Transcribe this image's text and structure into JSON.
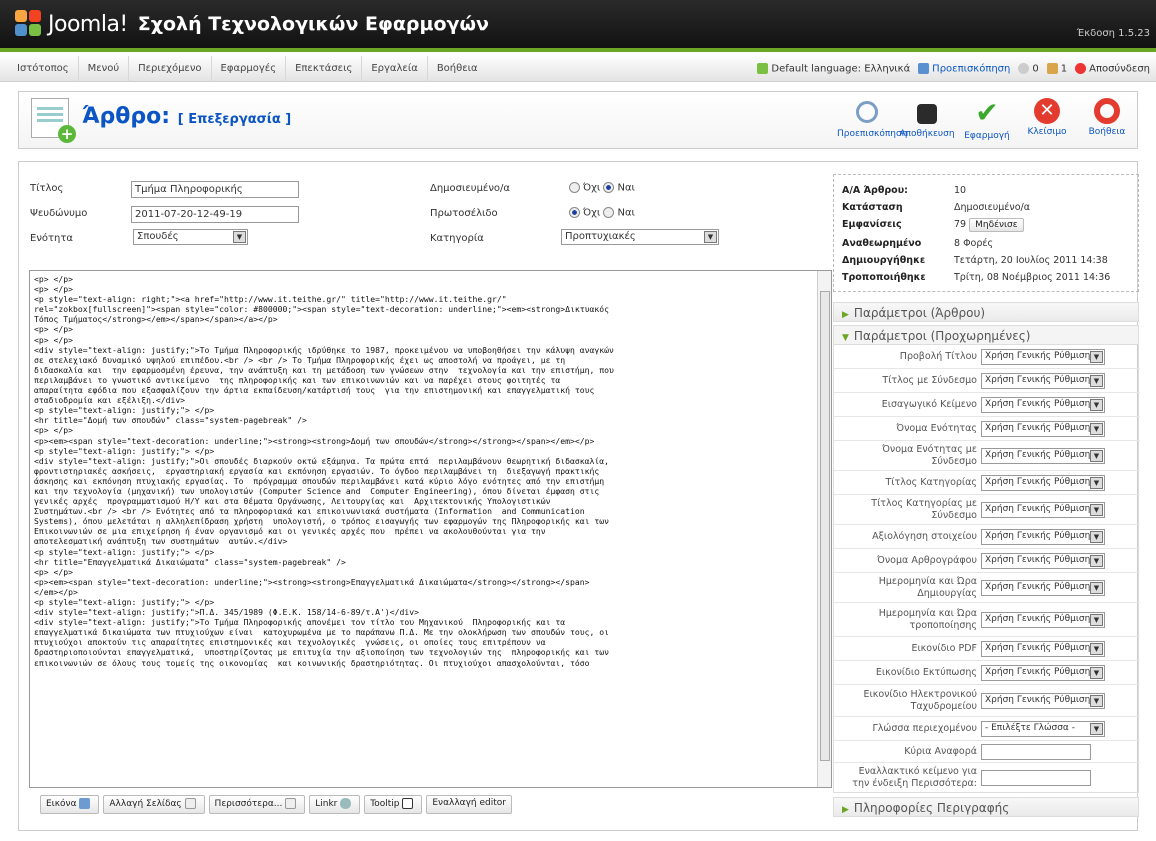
{
  "header": {
    "brand": "Joomla!",
    "site_name": "Σχολή Τεχνολογικών Εφαρμογών",
    "version": "Έκδοση 1.5.23"
  },
  "menu": [
    "Ιστότοπος",
    "Μενού",
    "Περιεχόμενο",
    "Εφαρμογές",
    "Επεκτάσεις",
    "Εργαλεία",
    "Βοήθεια"
  ],
  "status": {
    "language": "Default language: Ελληνικά",
    "preview": "Προεπισκόπηση",
    "messages": "0",
    "users": "1",
    "logout": "Αποσύνδεση"
  },
  "toolbar": {
    "title": "Άρθρο:",
    "subtitle": "[ Επεξεργασία ]",
    "buttons": [
      "Προεπισκόπηση",
      "Αποθήκευση",
      "Εφαρμογή",
      "Κλείσιμο",
      "Βοήθεια"
    ]
  },
  "form": {
    "title_label": "Τίτλος",
    "title_value": "Τμήμα Πληροφορικής",
    "alias_label": "Ψευδώνυμο",
    "alias_value": "2011-07-20-12-49-19",
    "section_label": "Ενότητα",
    "section_value": "Σπουδές",
    "published_label": "Δημοσιευμένο/α",
    "frontpage_label": "Πρωτοσέλιδο",
    "no": "Όχι",
    "yes": "Ναι",
    "category_label": "Κατηγορία",
    "category_value": "Προπτυχιακές"
  },
  "editor_code": "<p> </p>\n<p> </p>\n<p style=\"text-align: right;\"><a href=\"http://www.it.teithe.gr/\" title=\"http://www.it.teithe.gr/\"\nrel=\"zokbox[fullscreen]\"><span style=\"color: #800000;\"><span style=\"text-decoration: underline;\"><em><strong>Δικτυακός\nΤόπος Τμήματος</strong></em></span></span></a></p>\n<p> </p>\n<p> </p>\n<div style=\"text-align: justify;\">Το Τμήμα Πληροφορικής ιδρύθηκε το 1987, προκειμένου να υποβοηθήσει την κάλυψη αναγκών\nσε στελεχιακό δυναμικό υψηλού επιπέδου.<br /> <br /> Το Τμήμα Πληροφορικής έχει ως αποστολή να προάγει, με τη\nδιδασκαλία και  την εφαρμοσμένη έρευνα, την ανάπτυξη και τη μετάδοση των γνώσεων στην  τεχνολογία και την επιστήμη, που\nπεριλαμβάνει το γνωστικό αντικείμενο  της πληροφορικής και των επικοινωνιών και να παρέχει στους φοιτητές τα\nαπαραίτητα εφόδια που εξασφαλίζουν την άρτια εκπαίδευση/κατάρτισή τους  για την επιστημονική και επαγγελματική τους\nσταδιοδρομία και εξέλιξη.</div>\n<p style=\"text-align: justify;\"> </p>\n<hr title=\"Δομή των σπουδών\" class=\"system-pagebreak\" />\n<p> </p>\n<p><em><span style=\"text-decoration: underline;\"><strong><strong>Δομή των σπουδών</strong></strong></span></em></p>\n<p style=\"text-align: justify;\"> </p>\n<div style=\"text-align: justify;\">Οι σπουδές διαρκούν οκτώ εξάμηνα. Τα πρώτα επτά  περιλαμβάνουν θεωρητική διδασκαλία,\nφροντιστηριακές ασκήσεις,  εργαστηριακή εργασία και εκπόνηση εργασιών. Το όγδοο περιλαμβάνει τη  διεξαγωγή πρακτικής\nάσκησης και εκπόνηση πτυχιακής εργασίας. Το  πρόγραμμα σπουδών περιλαμβάνει κατά κύριο λόγο ενότητες από την επιστήμη\nκαι την τεχνολογία (μηχανική) των υπολογιστών (Computer Science and  Computer Engineering), όπου δίνεται έμφαση στις\nγενικές αρχές  προγραμματισμού Η/Υ και στα θέματα Οργάνωσης, Λειτουργίας και  Αρχιτεκτονικής Υπολογιστικών\nΣυστημάτων.<br /> <br /> Ενότητες από τα πληροφοριακά και επικοινωνιακά συστήματα (Information  and Communication\nSystems), όπου μελετάται η αλληλεπίδραση χρήστη  υπολογιστή, ο τρόπος εισαγωγής των εφαρμογών της Πληροφορικής και των\nΕπικοινωνιών σε μια επιχείρηση ή έναν οργανισμό και οι γενικές αρχές που  πρέπει να ακολουθούνται για την\nαποτελεσματική ανάπτυξη των συστημάτων  αυτών.</div>\n<p style=\"text-align: justify;\"> </p>\n<hr title=\"Επαγγελματικά Δικαιώματα\" class=\"system-pagebreak\" />\n<p> </p>\n<p><em><span style=\"text-decoration: underline;\"><strong><strong>Επαγγελματικά Δικαιώματα</strong></strong></span>\n</em></p>\n<p style=\"text-align: justify;\"> </p>\n<div style=\"text-align: justify;\">Π.Δ. 345/1989 (Φ.Ε.Κ. 158/14-6-89/τ.Α')</div>\n<div style=\"text-align: justify;\">Το Τμήμα Πληροφορικής απονέμει τον τίτλο του Μηχανικού  Πληροφορικής και τα\nεπαγγελματικά δικαιώματα των πτυχιούχων είναι  κατοχυρωμένα με το παράπανω Π.Δ. Με την ολοκλήρωση των σπουδών τους, οι\nπτυχιούχοι αποκτούν τις απαραίτητες επιστημονικές και τεχνολογικές  γνώσεις, οι οποίες τους επιτρέπουν να\nδραστηριοποιούνται επαγγελματικά,  υποστηρίζοντας με επιτυχία την αξιοποίηση των τεχνολογιών της  πληροφορικής και των\nεπικοινωνιών σε όλους τους τομείς της οικονομίας  και κοινωνικής δραστηριότητας. Οι πτυχιούχοι απασχολούνται, τόσο",
  "editor_buttons": [
    "Εικόνα",
    "Αλλαγή Σελίδας",
    "Περισσότερα...",
    "Linkr",
    "Tooltip",
    "Εναλλαγή editor"
  ],
  "info": {
    "id_label": "Α/Α Άρθρου:",
    "id_value": "10",
    "state_label": "Κατάσταση",
    "state_value": "Δημοσιευμένο/α",
    "hits_label": "Εμφανίσεις",
    "hits_value": "79",
    "reset": "Μηδένισε",
    "rev_label": "Αναθεωρημένο",
    "rev_value": "8 Φορές",
    "created_label": "Δημιουργήθηκε",
    "created_value": "Τετάρτη, 20 Ιουλίος 2011 14:38",
    "modified_label": "Τροποποιήθηκε",
    "modified_value": "Τρίτη, 08 Νοέμβριος 2011 14:36"
  },
  "accordion": {
    "article_params": "Παράμετροι (Άρθρου)",
    "advanced_params": "Παράμετροι (Προχωρημένες)",
    "meta": "Πληροφορίες Περιγραφής"
  },
  "params": [
    {
      "label": "Προβολή Τίτλου",
      "value": "Χρήση Γενικής Ρύθμισης"
    },
    {
      "label": "Τίτλος με Σύνδεσμο",
      "value": "Χρήση Γενικής Ρύθμισης"
    },
    {
      "label": "Εισαγωγικό Κείμενο",
      "value": "Χρήση Γενικής Ρύθμισης"
    },
    {
      "label": "Όνομα Ενότητας",
      "value": "Χρήση Γενικής Ρύθμισης"
    },
    {
      "label": "Όνομα Ενότητας με Σύνδεσμο",
      "value": "Χρήση Γενικής Ρύθμισης"
    },
    {
      "label": "Τίτλος Κατηγορίας",
      "value": "Χρήση Γενικής Ρύθμισης"
    },
    {
      "label": "Τίτλος Κατηγορίας με Σύνδεσμο",
      "value": "Χρήση Γενικής Ρύθμισης"
    },
    {
      "label": "Αξιολόγηση στοιχείου",
      "value": "Χρήση Γενικής Ρύθμισης"
    },
    {
      "label": "Όνομα Αρθρογράφου",
      "value": "Χρήση Γενικής Ρύθμισης"
    },
    {
      "label": "Ημερομηνία και Ώρα Δημιουργίας",
      "value": "Χρήση Γενικής Ρύθμισης"
    },
    {
      "label": "Ημερομηνία και Ώρα τροποποίησης",
      "value": "Χρήση Γενικής Ρύθμισης"
    },
    {
      "label": "Εικονίδιο PDF",
      "value": "Χρήση Γενικής Ρύθμισης"
    },
    {
      "label": "Εικονίδιο Εκτύπωσης",
      "value": "Χρήση Γενικής Ρύθμισης"
    },
    {
      "label": "Εικονίδιο Ηλεκτρονικού Ταχυδρομείου",
      "value": "Χρήση Γενικής Ρύθμισης"
    },
    {
      "label": "Γλώσσα περιεχομένου",
      "value": "- Επιλέξτε Γλώσσα -"
    },
    {
      "label": "Κύρια Αναφορά",
      "value": ""
    },
    {
      "label": "Εναλλακτικό κείμενο για την ένδειξη Περισσότερα:",
      "value": ""
    }
  ]
}
